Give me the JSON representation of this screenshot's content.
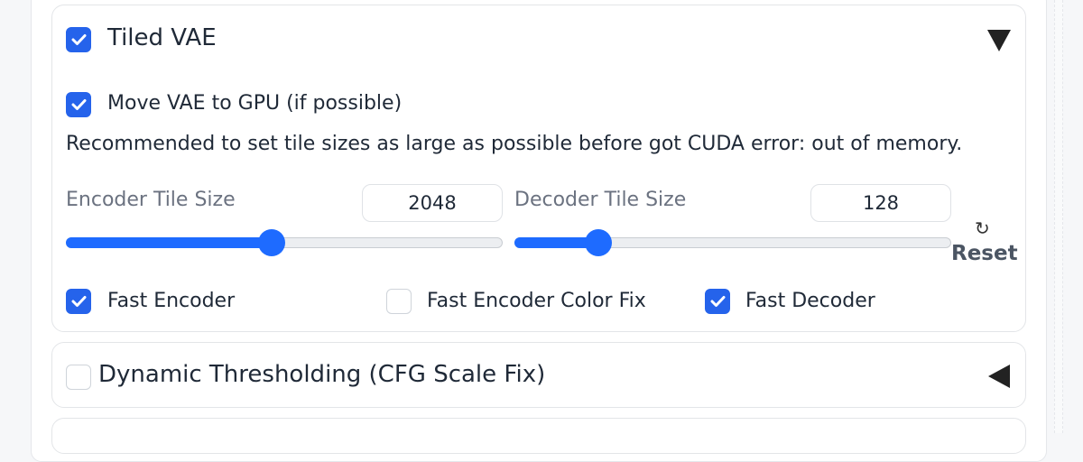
{
  "tiled_vae": {
    "title": "Tiled VAE",
    "enabled": true,
    "move_vae_to_gpu": {
      "label": "Move VAE to GPU (if possible)",
      "checked": true
    },
    "note": "Recommended to set tile sizes as large as possible before got CUDA error: out of memory.",
    "encoder_tile_size": {
      "label": "Encoder Tile Size",
      "value": "2048",
      "slider_fraction": 0.47
    },
    "decoder_tile_size": {
      "label": "Decoder Tile Size",
      "value": "128",
      "slider_fraction": 0.19
    },
    "reset": {
      "icon": "↻",
      "label": "Reset"
    },
    "fast_encoder": {
      "label": "Fast Encoder",
      "checked": true
    },
    "fast_encoder_color_fix": {
      "label": "Fast Encoder Color Fix",
      "checked": false
    },
    "fast_decoder": {
      "label": "Fast Decoder",
      "checked": true
    },
    "expanded": true
  },
  "dynamic_thresholding": {
    "title": "Dynamic Thresholding (CFG Scale Fix)",
    "enabled": false,
    "expanded": false
  },
  "colors": {
    "accent": "#2563eb",
    "slider": "#1e6bff"
  }
}
